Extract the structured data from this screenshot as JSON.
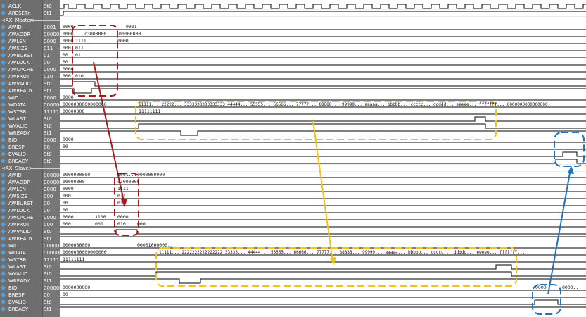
{
  "groups": {
    "master": "<AXI Master>",
    "slave": "<AXI Slave>"
  },
  "colors": {
    "panel": "#6e6e6e",
    "icon": "#4aa3e8",
    "trace": "#000000",
    "red_annotation": "#b01919",
    "yellow_annotation": "#f2c318",
    "blue_annotation": "#1f73bd"
  },
  "signals": {
    "top": [
      {
        "name": "ACLK",
        "value": "St0"
      },
      {
        "name": "ARESETn",
        "value": "St1"
      }
    ],
    "master": [
      {
        "name": "AWID",
        "value": "0001"
      },
      {
        "name": "AWADDR",
        "value": "00000000"
      },
      {
        "name": "AWLEN",
        "value": "0000"
      },
      {
        "name": "AWSIZE",
        "value": "011"
      },
      {
        "name": "AWBURST",
        "value": "01"
      },
      {
        "name": "AWLOCK",
        "value": "00"
      },
      {
        "name": "AWCACHE",
        "value": "0000"
      },
      {
        "name": "AWPROT",
        "value": "010"
      },
      {
        "name": "AWVALID",
        "value": "St0"
      },
      {
        "name": "AWREADY",
        "value": "St1"
      },
      {
        "name": "WID",
        "value": "0000"
      },
      {
        "name": "WDATA",
        "value": "00000000"
      },
      {
        "name": "WSTRB",
        "value": "11111111"
      },
      {
        "name": "WLAST",
        "value": "St0"
      },
      {
        "name": "WVALID",
        "value": "St0"
      },
      {
        "name": "WREADY",
        "value": "St1"
      },
      {
        "name": "BID",
        "value": "0000"
      },
      {
        "name": "BRESP",
        "value": "00"
      },
      {
        "name": "BVALID",
        "value": "St0"
      },
      {
        "name": "BREADY",
        "value": "St0"
      }
    ],
    "slave": [
      {
        "name": "AWID",
        "value": "00000000"
      },
      {
        "name": "AWADDR",
        "value": "00000000"
      },
      {
        "name": "AWLEN",
        "value": "0000"
      },
      {
        "name": "AWSIZE",
        "value": "000"
      },
      {
        "name": "AWBURST",
        "value": "00"
      },
      {
        "name": "AWLOCK",
        "value": "00"
      },
      {
        "name": "AWCACHE",
        "value": "0000"
      },
      {
        "name": "AWPROT",
        "value": "000"
      },
      {
        "name": "AWVALID",
        "value": "St0"
      },
      {
        "name": "AWREADY",
        "value": "St1"
      },
      {
        "name": "WID",
        "value": "00000100"
      },
      {
        "name": "WDATA",
        "value": "00000000"
      },
      {
        "name": "WSTRB",
        "value": "11111111"
      },
      {
        "name": "WLAST",
        "value": "St0"
      },
      {
        "name": "WVALID",
        "value": "St0"
      },
      {
        "name": "WREADY",
        "value": "St1"
      },
      {
        "name": "BID",
        "value": "00000000"
      },
      {
        "name": "BRESP",
        "value": "00"
      },
      {
        "name": "BVALID",
        "value": "St0"
      },
      {
        "name": "BREADY",
        "value": "St1"
      }
    ]
  },
  "wave_values": {
    "m_awid_a": "0000",
    "m_awid_b": "0001",
    "m_awaddr_a": "0000...",
    "m_awaddr_b": "c3000000",
    "m_awaddr_c": "00000000",
    "m_awlen_a": "0000",
    "m_awlen_b": "1111",
    "m_awlen_c": "0000",
    "m_awsize_a": "000",
    "m_awsize_b": "011",
    "m_awburst_a": "00",
    "m_awburst_b": "01",
    "m_awlock": "00",
    "m_awcache": "0000",
    "m_awprot_a": "000",
    "m_awprot_b": "010",
    "m_wid": "0000",
    "m_wdata_a": "0000000000000000",
    "m_wdata_b": "11111...  22222...  3333333333333333  44444...  55555...  66666...  77777...  88888...  99999...  aaaaa...  bbbbb...  ccccc...  ddddd...  eeeee...  fffffff...  0000000000000000",
    "m_wstrb_a": "00000000",
    "m_wstrb_b": "11111111",
    "m_bid": "0000",
    "m_bresp": "00",
    "s_awid_a": "0000000000",
    "s_awid_b": "0001...",
    "s_awid_c": "0000000000",
    "s_awaddr_a": "00000000",
    "s_awaddr_b": "c3000000",
    "s_awlen_a": "0000",
    "s_awlen_b": "1111",
    "s_awsize_a": "000",
    "s_awsize_b": "011",
    "s_awburst_a": "00",
    "s_awburst_b": "01",
    "s_awlock": "00",
    "s_awcache_a": "0000",
    "s_awcache_b": "1100",
    "s_awcache_c": "0000",
    "s_awprot_a": "000",
    "s_awprot_b": "001",
    "s_awprot_c": "010",
    "s_awprot_d": "000",
    "s_wid_a": "0000000000",
    "s_wid_b": "00001000000...",
    "s_wdata_a": "0000000000000000",
    "s_wdata_b": "11111...  2222222222222222  33333...  44444...  55555...  66666...  77777...  88888...  99999...  aaaaa...  bbbbb...  ccccc...  ddddd...  eeeee...  fffffff...",
    "s_wstrb": "11111111",
    "s_bid_a": "0000000000",
    "s_bid_b": "0000",
    "s_bid_c": "0000...",
    "s_bresp": "00"
  }
}
